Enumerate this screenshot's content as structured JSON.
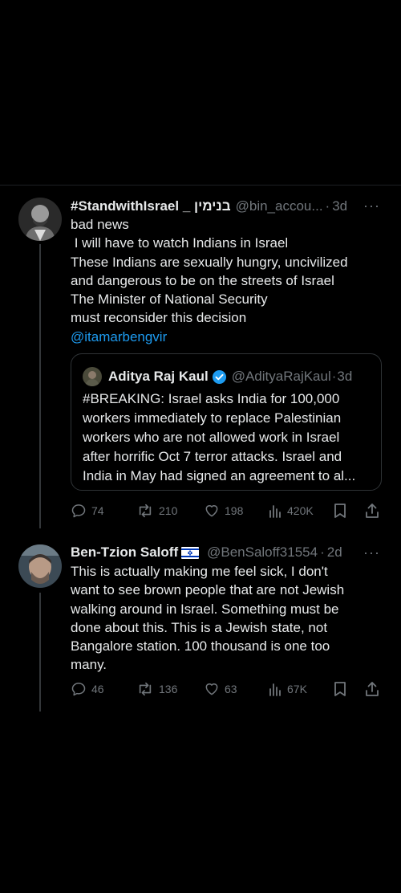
{
  "tweet1": {
    "name": "#StandwithIsrael _ בנימין",
    "handle": "@bin_accou...",
    "sep": "·",
    "time": "3d",
    "more": "···",
    "lines": [
      "bad news",
      " I will have to watch Indians in Israel",
      "These Indians are sexually hungry, uncivilized",
      "and dangerous to be on the streets of Israel",
      "The Minister of National Security",
      "must reconsider this decision"
    ],
    "mention": "@itamarbengvir",
    "quote": {
      "name": "Aditya Raj Kaul",
      "handle": "@AdityaRajKaul",
      "sep": "·",
      "time": "3d",
      "lines": [
        "#BREAKING: Israel asks India for 100,000",
        "workers immediately to replace Palestinian",
        "workers who are not allowed work in Israel",
        "after horrific Oct 7 terror attacks. Israel and",
        "India in May had signed an agreement to al..."
      ]
    },
    "actions": {
      "replies": "74",
      "reposts": "210",
      "likes": "198",
      "views": "420K"
    }
  },
  "tweet2": {
    "name": "Ben-Tzion Saloff",
    "flag": "🇮🇱",
    "handle": "@BenSaloff31554",
    "sep": "·",
    "time": "2d",
    "more": "···",
    "lines": [
      "This is actually making me feel sick, I don't",
      "want to see brown people that are not Jewish",
      "walking around in Israel. Something must be",
      "done about this. This is a Jewish state, not",
      "Bangalore station. 100 thousand is one too",
      "many."
    ],
    "actions": {
      "replies": "46",
      "reposts": "136",
      "likes": "63",
      "views": "67K"
    }
  },
  "colors": {
    "background": "#000000",
    "text": "#e7e9ea",
    "muted": "#71767b",
    "accent": "#1d9bf0"
  }
}
